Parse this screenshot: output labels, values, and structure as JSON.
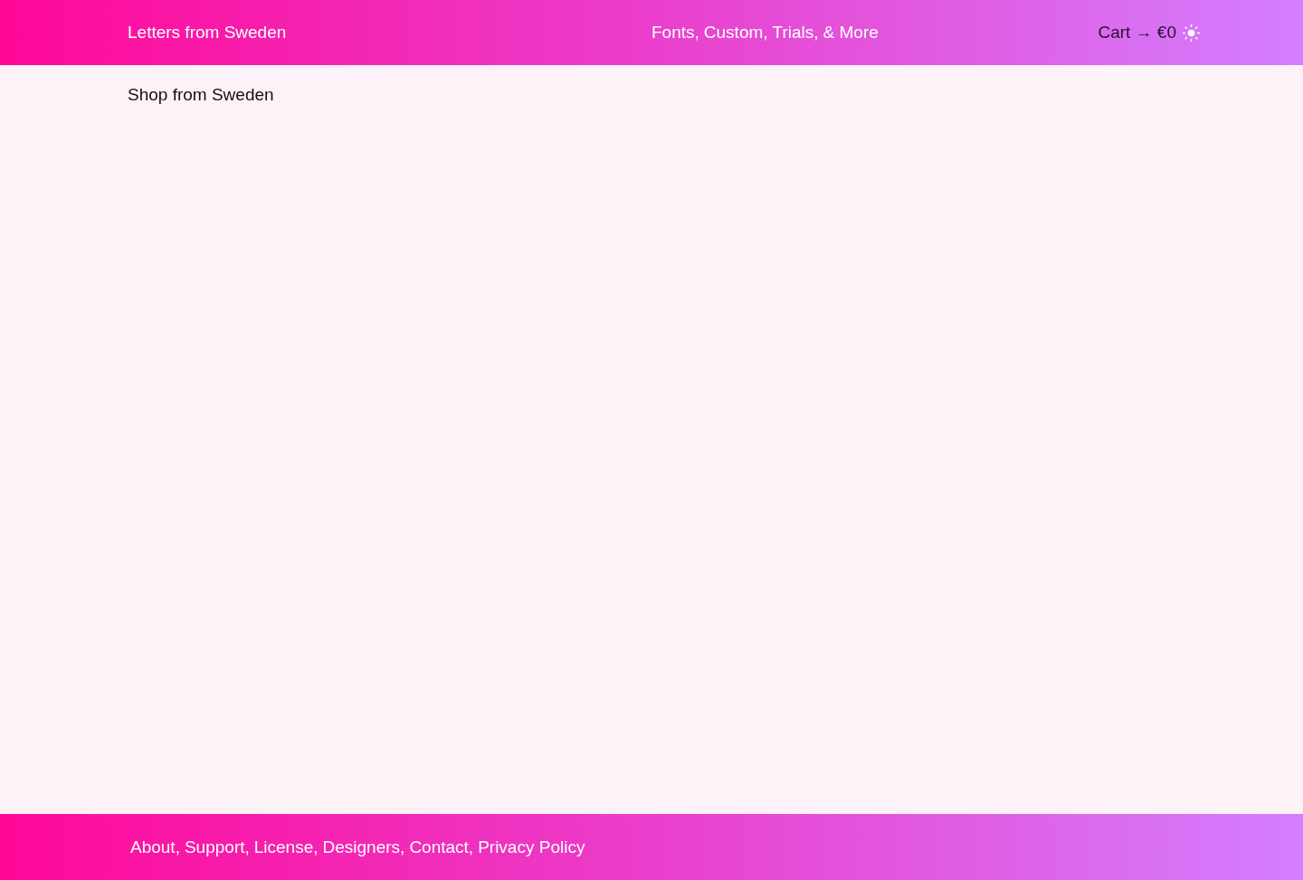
{
  "header": {
    "site_title": "Letters from Sweden",
    "nav": [
      {
        "label": "Fonts,"
      },
      {
        "label": "Custom,"
      },
      {
        "label": "Trials,"
      },
      {
        "label": "& More"
      }
    ],
    "cart": {
      "label": "Cart → €0"
    }
  },
  "main": {
    "heading": "Shop from Sweden"
  },
  "footer": {
    "links": [
      {
        "label": "About,"
      },
      {
        "label": "Support,"
      },
      {
        "label": "License,"
      },
      {
        "label": "Designers,"
      },
      {
        "label": "Contact,"
      },
      {
        "label": "Privacy Policy"
      }
    ]
  }
}
